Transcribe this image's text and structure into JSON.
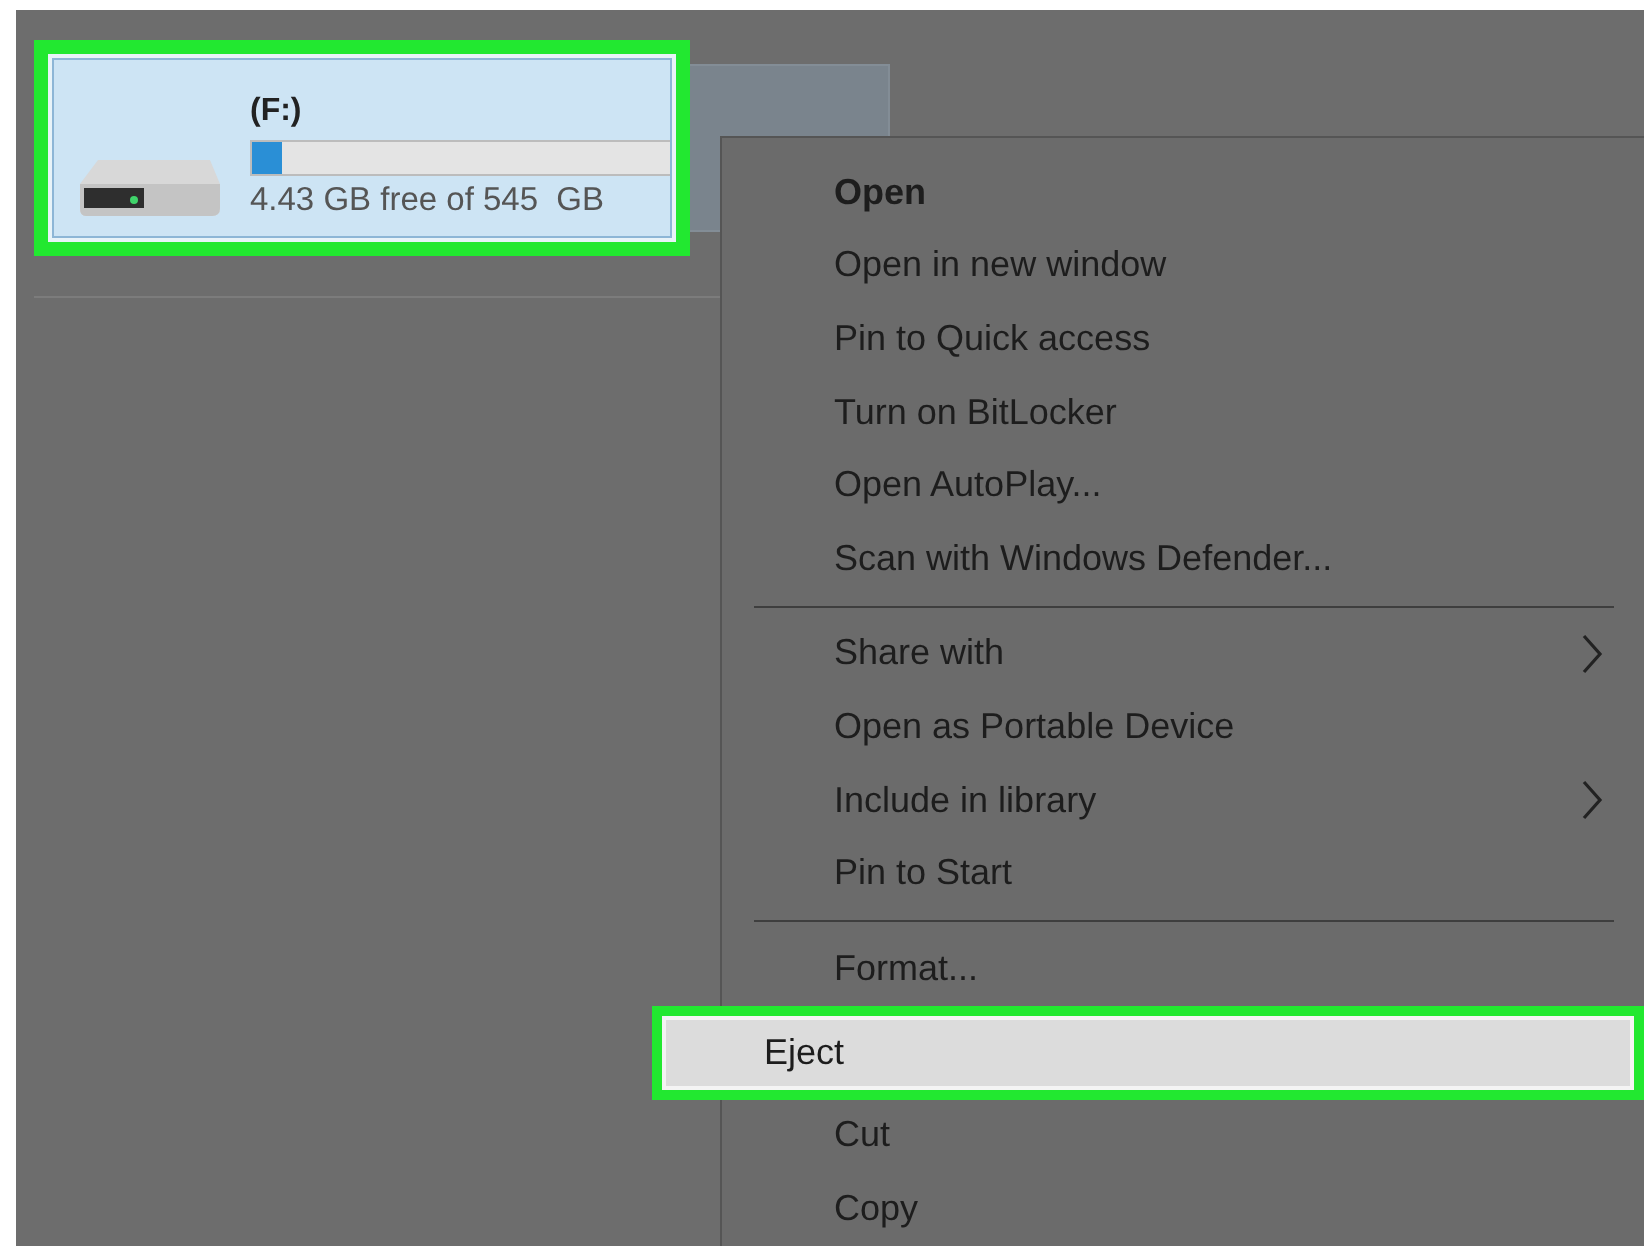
{
  "drive": {
    "name": "(F:)",
    "level": 0.07,
    "free_space": "4.43 GB free of 545  GB",
    "selected": true,
    "callout": true
  },
  "context_menu": {
    "items": [
      {
        "kind": "item",
        "label": "Open",
        "default": true,
        "submenu": false,
        "selected": false,
        "callout": false
      },
      {
        "kind": "item",
        "label": "Open in new window",
        "default": false,
        "submenu": false,
        "selected": false,
        "callout": false
      },
      {
        "kind": "item",
        "label": "Pin to Quick access",
        "default": false,
        "submenu": false,
        "selected": false,
        "callout": false
      },
      {
        "kind": "item",
        "label": "Turn on BitLocker",
        "default": false,
        "submenu": false,
        "selected": false,
        "callout": false
      },
      {
        "kind": "item",
        "label": "Open AutoPlay...",
        "default": false,
        "submenu": false,
        "selected": false,
        "callout": false
      },
      {
        "kind": "item",
        "label": "Scan with Windows Defender...",
        "default": false,
        "submenu": false,
        "selected": false,
        "callout": false
      },
      {
        "kind": "separator"
      },
      {
        "kind": "item",
        "label": "Share with",
        "default": false,
        "submenu": true,
        "selected": false,
        "callout": false
      },
      {
        "kind": "item",
        "label": "Open as Portable Device",
        "default": false,
        "submenu": false,
        "selected": false,
        "callout": false
      },
      {
        "kind": "item",
        "label": "Include in library",
        "default": false,
        "submenu": true,
        "selected": false,
        "callout": false
      },
      {
        "kind": "item",
        "label": "Pin to Start",
        "default": false,
        "submenu": false,
        "selected": false,
        "callout": false
      },
      {
        "kind": "separator"
      },
      {
        "kind": "item",
        "label": "Format...",
        "default": false,
        "submenu": false,
        "selected": false,
        "callout": false
      },
      {
        "kind": "item",
        "label": "Eject",
        "default": false,
        "submenu": false,
        "selected": true,
        "callout": true
      },
      {
        "kind": "item",
        "label": "Cut",
        "default": false,
        "submenu": false,
        "selected": false,
        "callout": false
      },
      {
        "kind": "item",
        "label": "Copy",
        "default": false,
        "submenu": false,
        "selected": false,
        "callout": false
      }
    ]
  }
}
